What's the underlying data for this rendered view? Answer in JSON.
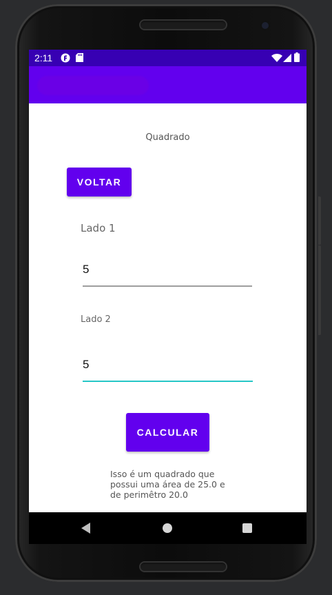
{
  "status_bar": {
    "time": "2:11"
  },
  "screen": {
    "title": "Quadrado",
    "back_button_label": "VOLTAR",
    "side1_label": "Lado 1",
    "side1_value": "5",
    "side2_label": "Lado 2",
    "side2_value": "5",
    "calculate_button_label": "CALCULAR",
    "result_text": "Isso é um quadrado que possui uma área de 25.0 e de perimêtro 20.0"
  },
  "colors": {
    "primary": "#6200ee",
    "primary_dark": "#3700b3",
    "accent": "#03dac5"
  },
  "icons": {
    "status_left": [
      "f-notification-icon",
      "sd-card-icon"
    ],
    "status_right": [
      "wifi-icon",
      "cell-signal-icon",
      "battery-icon"
    ],
    "navigation": [
      "back-icon",
      "home-icon",
      "recents-icon"
    ]
  }
}
